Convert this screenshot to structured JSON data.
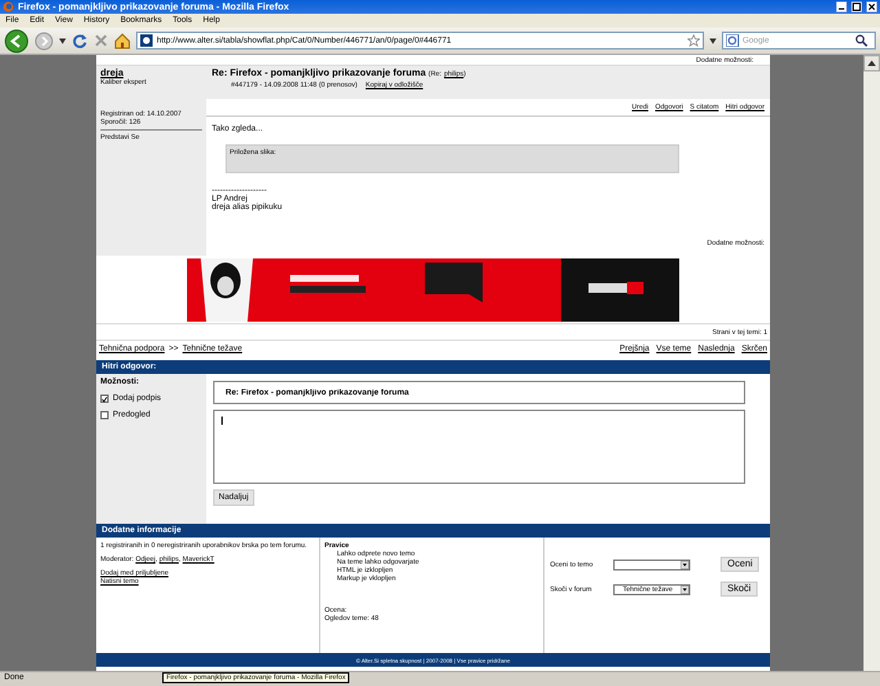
{
  "browser": {
    "title": "Firefox - pomanjkljivo prikazovanje foruma - Mozilla Firefox",
    "menu": [
      "File",
      "Edit",
      "View",
      "History",
      "Bookmarks",
      "Tools",
      "Help"
    ],
    "url": "http://www.alter.si/tabla/showflat.php/Cat/0/Number/446771/an/0/page/0#446771",
    "search_placeholder": "Google"
  },
  "post": {
    "top_more": "Dodatne možnosti:",
    "author": "dreja",
    "rank": "Kaliber ekspert",
    "registered": "Registriran od: 14.10.2007",
    "count": "Sporočil: 126",
    "profile": "Predstavi Se",
    "title": "Re: Firefox - pomanjkljivo prikazovanje foruma",
    "re_open": "(Re:",
    "re_user": "philips",
    "re_close": ")",
    "meta": "#447179 - 14.09.2008 11:48 (0 prenosov)",
    "copy": "Kopiraj v odložišče",
    "actions": [
      "Uredi",
      "Odgovori",
      "S citatom",
      "Hitri odgovor"
    ],
    "text": "Tako zgleda...",
    "attachment": "Priložena slika:",
    "signature": [
      "--------------------",
      "LP Andrej",
      "dreja alias pipikuku"
    ],
    "more": "Dodatne možnosti:"
  },
  "pages": "Strani v tej temi: 1",
  "breadcrumb": {
    "items": [
      "Tehnična podpora",
      "Tehnične težave"
    ],
    "separator": ">>"
  },
  "nav": [
    "Prejšnja",
    "Vse teme",
    "Naslednja",
    "Skrčen"
  ],
  "reply": {
    "header": "Hitri odgovor:",
    "options_label": "Možnosti:",
    "options": [
      {
        "label": "Dodaj podpis",
        "checked": true
      },
      {
        "label": "Predogled",
        "checked": false
      }
    ],
    "subject": "Re: Firefox - pomanjkljivo prikazovanje foruma",
    "button": "Nadaljuj"
  },
  "info": {
    "header": "Dodatne informacije",
    "online": "1 registriranih in 0 neregistriranih uporabnikov brska po tem forumu.",
    "moderator_label": "Moderator:",
    "moderators": [
      "Odjeej",
      "philips",
      "MaverickT"
    ],
    "moderator_separator": ",",
    "links": [
      "Dodaj med priljubljene",
      "Natisni temo"
    ],
    "rights_title": "Pravice",
    "rights": [
      "Lahko odprete novo temo",
      "Na teme lahko odgovarjate",
      "HTML je izklopljen",
      "Markup je vklopljen"
    ],
    "rating": "Ocena:",
    "views": "Ogledov teme: 48",
    "rate_label": "Oceni to temo",
    "rate_button": "Oceni",
    "jump_label": "Skoči v forum",
    "jump_value": "Tehnične težave",
    "jump_button": "Skoči"
  },
  "footer": "© Alter.Si spletna skupnost | 2007-2008 | Vse pravice pridržane",
  "status": "Done",
  "tooltip": "Firefox - pomanjkljivo prikazovanje foruma - Mozilla Firefox"
}
